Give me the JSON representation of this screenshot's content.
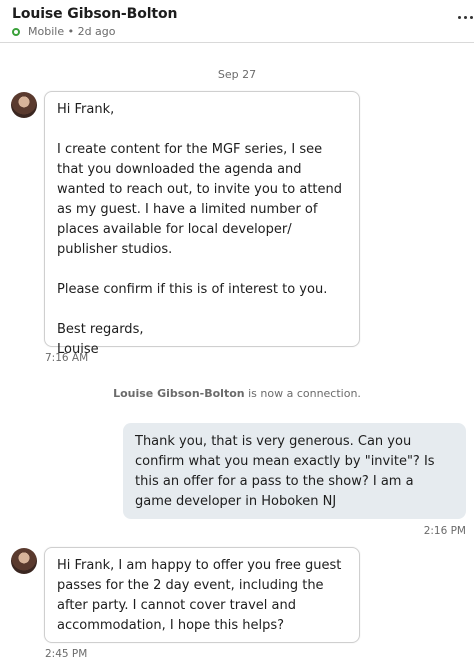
{
  "header": {
    "contact_name": "Louise Gibson-Bolton",
    "status_text": "Mobile • 2d ago",
    "status_color": "#3aa13a",
    "menu_icon": "more-horizontal-icon"
  },
  "thread": {
    "date_separator": "Sep 27",
    "messages": [
      {
        "direction": "incoming",
        "paragraphs": [
          "Hi Frank,",
          "I create content for the MGF series, I see that you downloaded the agenda and wanted to reach out, to invite you to attend as my guest. I have a limited number of places available for local developer/ publisher studios.",
          "Please confirm if this is of interest to you.",
          "Best regards,\nLouise"
        ],
        "time": "7:16 AM"
      },
      {
        "direction": "system",
        "name": "Louise Gibson-Bolton",
        "text": " is now a connection."
      },
      {
        "direction": "outgoing",
        "text": "Thank you, that is very generous. Can you confirm what you mean exactly by \"invite\"? Is this an offer for a pass to the show? I am a game developer in Hoboken NJ",
        "time": "2:16 PM"
      },
      {
        "direction": "incoming",
        "text": "Hi Frank, I am happy to offer you free guest passes for the 2 day event, including the after party. I cannot cover travel and accommodation, I hope this helps?",
        "time": "2:45 PM"
      }
    ]
  }
}
